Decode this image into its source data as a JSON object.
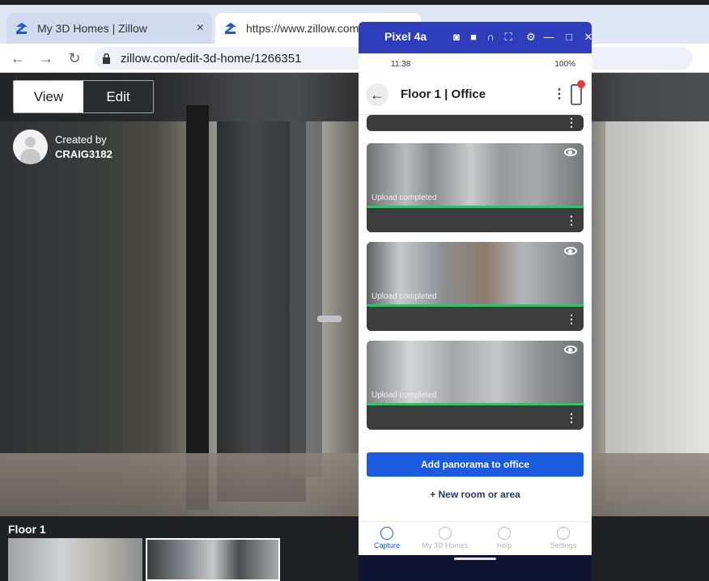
{
  "browser": {
    "tabs": [
      {
        "title": "My 3D Homes | Zillow",
        "close": "×"
      },
      {
        "title": "https://www.zillow.com/e",
        "close": ""
      }
    ],
    "url": "zillow.com/edit-3d-home/1266351"
  },
  "page": {
    "toggle": {
      "view": "View",
      "edit": "Edit"
    },
    "creator": {
      "label": "Created by",
      "name": "CRAIG3182"
    },
    "floor_label": "Floor 1"
  },
  "emulator": {
    "device_name": "Pixel 4a",
    "status": {
      "time": "11:38",
      "battery": "100%"
    },
    "app": {
      "title": "Floor 1 | Office",
      "cards": [
        {
          "status": "Upload completed"
        },
        {
          "status": "Upload completed"
        },
        {
          "status": "Upload completed"
        }
      ],
      "add_button": "Add panorama to office",
      "new_room": "New room or area",
      "nav": [
        "Capture",
        "My 3D Homes",
        "Help",
        "Settings"
      ]
    }
  },
  "colors": {
    "accent": "#1a5ae0",
    "emulator_title": "#2e3dbb",
    "progress": "#33c26a"
  }
}
